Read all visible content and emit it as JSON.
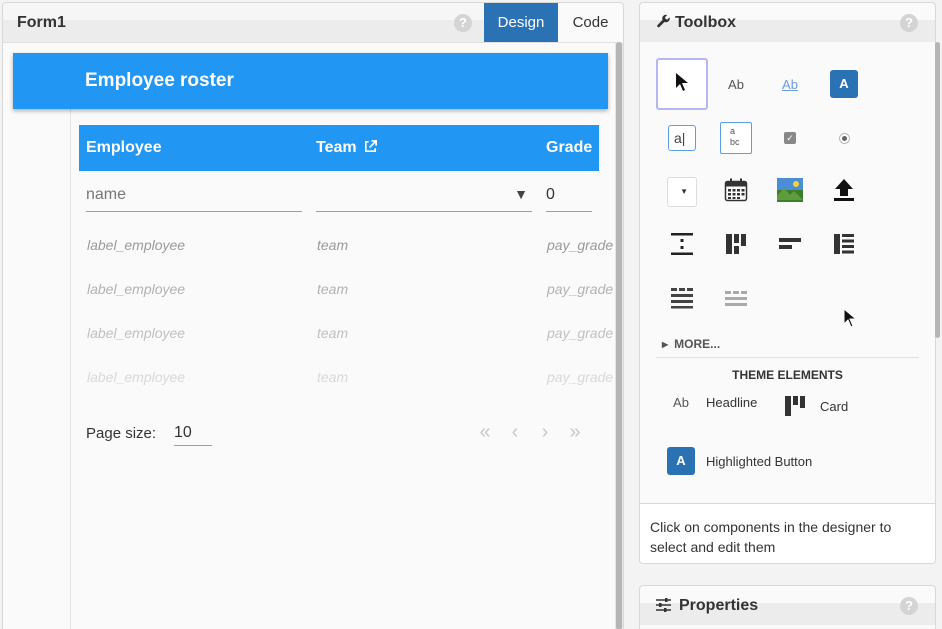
{
  "form": {
    "title": "Form1",
    "help": "?",
    "tabs": [
      {
        "label": "Design",
        "active": true
      },
      {
        "label": "Code",
        "active": false
      }
    ],
    "heading": "Employee roster",
    "grid": {
      "columns": [
        "Employee",
        "Team",
        "Grade"
      ],
      "filters": {
        "name_placeholder": "name",
        "team_value": "",
        "grade_value": "0",
        "dropdown_caret": "▼"
      },
      "rows": [
        {
          "employee": "label_employee",
          "team": "team",
          "grade": "pay_grade"
        },
        {
          "employee": "label_employee",
          "team": "team",
          "grade": "pay_grade"
        },
        {
          "employee": "label_employee",
          "team": "team",
          "grade": "pay_grade"
        },
        {
          "employee": "label_employee",
          "team": "team",
          "grade": "pay_grade"
        }
      ]
    },
    "pager": {
      "page_size_label": "Page size:",
      "page_size_value": "10",
      "first": "«",
      "prev": "‹",
      "next": "›",
      "last": "»"
    }
  },
  "toolbox": {
    "title": "Toolbox",
    "help": "?",
    "tools": {
      "label_text": "Ab",
      "link_text": "Ab",
      "button_text": "A",
      "textbox_text": "a",
      "textarea_line1": "a",
      "textarea_line2": "bc",
      "check_mark": "✓",
      "dropdown_caret": "▼"
    },
    "more_label": "MORE...",
    "theme_section": "THEME ELEMENTS",
    "theme_items": [
      {
        "icon_text": "Ab",
        "label": "Headline"
      },
      {
        "label": "Card"
      },
      {
        "icon_text": "A",
        "label": "Highlighted Button"
      }
    ],
    "footer_text": "Click on components in the designer to select and edit them"
  },
  "properties": {
    "title": "Properties",
    "help": "?"
  },
  "colors": {
    "accent": "#2196f3",
    "tab_active": "#2b72b4"
  }
}
